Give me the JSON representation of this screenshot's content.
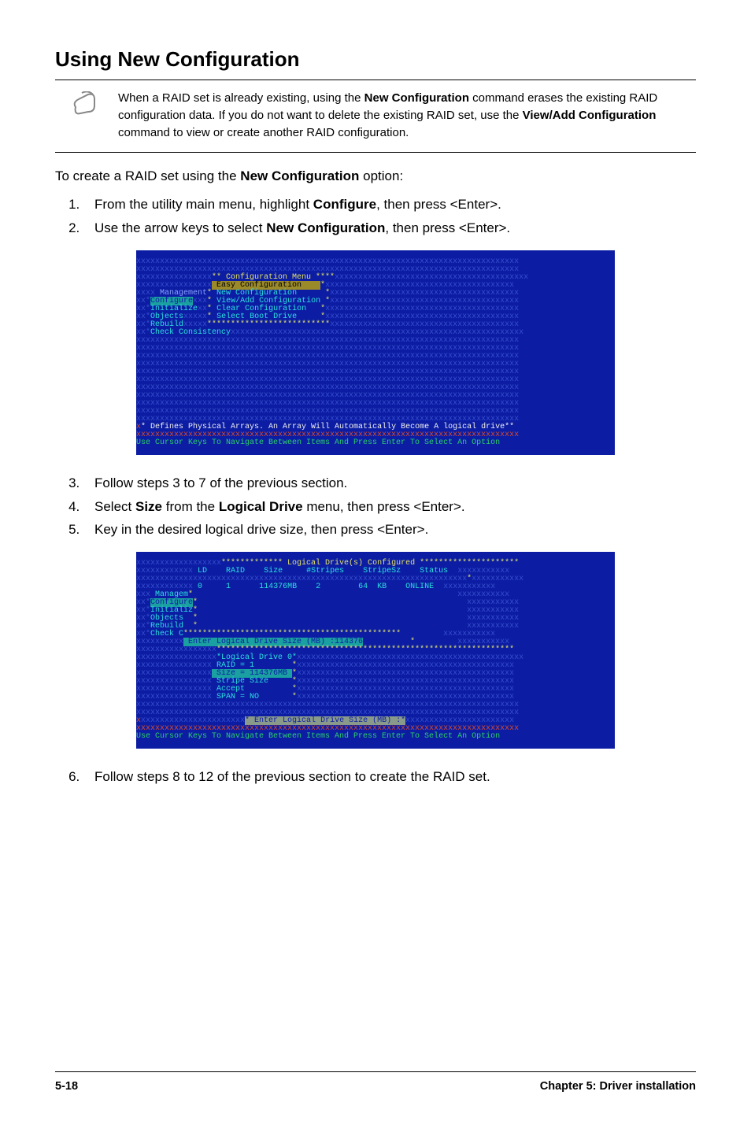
{
  "title": "Using New Configuration",
  "note": {
    "text_parts": [
      "When a RAID set is already existing, using the ",
      "New Configuration",
      " command erases the existing RAID configuration data. If you do not want to delete the existing RAID set, use the ",
      "View/Add Configuration",
      " command to view or create another RAID configuration."
    ]
  },
  "lead": {
    "pre": "To create a RAID set using the ",
    "bold": "New Configuration",
    "post": " option:"
  },
  "steps1": [
    {
      "pre": "From the utility main menu, highlight ",
      "b1": "Configure",
      "post": ", then press <Enter>."
    },
    {
      "pre": "Use the arrow keys to select ",
      "b1": "New Configuration",
      "post": ", then press <Enter>."
    }
  ],
  "bios1": {
    "menu_title": "** Configuration Menu ****",
    "easy": " Easy Configuration    ",
    "left": {
      "management": " Management",
      "configure": "Configure",
      "initialize": "Initialize",
      "objects": "Objects",
      "rebuild": "Rebuild",
      "check": "Check Consistency"
    },
    "options": {
      "newcfg": "New Configuration",
      "view": "View/Add Configuration",
      "clearcfg": "Clear Configuration",
      "boot": "Select Boot Drive"
    },
    "desc": "* Defines Physical Arrays. An Array Will Automatically Become A logical drive**",
    "hint": "Use Cursor Keys To Navigate Between Items And Press Enter To Select An Option"
  },
  "steps2": [
    {
      "text": "Follow steps 3 to 7 of the previous section."
    },
    {
      "pre": "Select ",
      "b1": "Size",
      "mid": " from the ",
      "b2": "Logical Drive",
      "post": " menu, then press <Enter>."
    },
    {
      "text": "Key in the desired logical drive size, then press <Enter>."
    }
  ],
  "bios2": {
    "table_title": "************* Logical Drive(s) Configured *********************",
    "headers": {
      "ld": "LD",
      "raid": "RAID",
      "size": "Size",
      "stripes": "#Stripes",
      "stripesz": "StripeSz",
      "status": "Status"
    },
    "row": {
      "ld": "0",
      "raid": "1",
      "size": "114376MB",
      "stripes": "2",
      "stripesz": "64  KB",
      "status": "ONLINE"
    },
    "left": {
      "management": "Managem",
      "configure": "Configure",
      "initialize": "Initializ",
      "objects": "Objects",
      "rebuild": "Rebuild",
      "check": "Check C"
    },
    "input_label": " Enter Logical Drive Size (MB) :114376",
    "ld0": {
      "title": "*Logical Drive 0*",
      "raid": " RAID = 1",
      "size": " Size = 114376MB ",
      "stripe": " Stripe Size",
      "accept": " Accept",
      "span": " SPAN = NO"
    },
    "msg": "* Enter Logical Drive Size (MB) :*",
    "hint": "Use Cursor Keys To Navigate Between Items And Press Enter To Select An Option"
  },
  "step6": {
    "text": "Follow steps 8 to 12 of the previous section to create the RAID set."
  },
  "footer": {
    "left": "5-18",
    "right": "Chapter 5: Driver installation"
  }
}
